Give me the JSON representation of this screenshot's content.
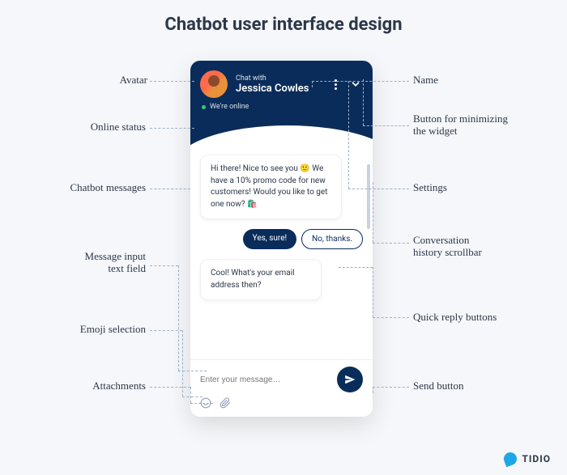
{
  "title": "Chatbot user interface design",
  "header": {
    "chat_with": "Chat with",
    "agent_name": "Jessica Cowles",
    "status_text": "We're online"
  },
  "messages": {
    "bot1": "Hi there! Nice to see you 🙂 We have a 10% promo code for new customers! Would you like to get one now? 🛍️",
    "qr_yes": "Yes, sure!",
    "qr_no": "No, thanks.",
    "bot2": "Cool! What's your email address then?"
  },
  "input": {
    "placeholder": "Enter your message…"
  },
  "labels": {
    "avatar": "Avatar",
    "online_status": "Online status",
    "chatbot_messages": "Chatbot messages",
    "message_input": "Message input\ntext field",
    "emoji_selection": "Emoji selection",
    "attachments": "Attachments",
    "name": "Name",
    "minimize": "Button for minimizing\nthe widget",
    "settings": "Settings",
    "scrollbar": "Conversation\nhistory scrollbar",
    "quick_reply": "Quick reply buttons",
    "send_button": "Send button"
  },
  "brand": "TIDIO"
}
